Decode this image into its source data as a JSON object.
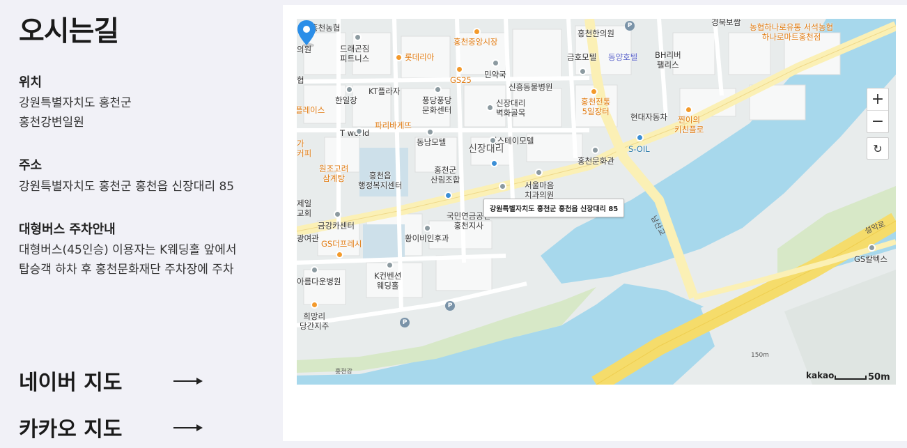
{
  "heading": "오시는길",
  "location": {
    "label": "위치",
    "line1": "강원특별자치도 홍천군",
    "line2": "홍천강변일원"
  },
  "address": {
    "label": "주소",
    "value": "강원특별자치도 홍천군 홍천읍 신장대리 85"
  },
  "bus": {
    "label": "대형버스 주차안내",
    "line1": "대형버스(45인승) 이용자는 K웨딩홀 앞에서",
    "line2": "탑승객 하차 후 홍천문화재단 주차장에 주차"
  },
  "links": {
    "naver": "네이버 지도",
    "kakao": "카카오 지도"
  },
  "map": {
    "callout": "강원특별자치도 홍천군 홍천읍 신장대리 85",
    "zoom_in": "+",
    "zoom_out": "−",
    "reset": "↻",
    "brand": "kakao",
    "scale": "50m",
    "labels": [
      {
        "t": "홍천농협",
        "c": ""
      },
      {
        "t": "드래곤짐\n피트니스",
        "c": ""
      },
      {
        "t": "롯데리아",
        "c": "o"
      },
      {
        "t": "홍천중앙시장",
        "c": "o"
      },
      {
        "t": "홍천한의원",
        "c": ""
      },
      {
        "t": "경북보쌈",
        "c": ""
      },
      {
        "t": "농협하나로유통 서석농협\n하나로마트홍천점",
        "c": "o"
      },
      {
        "t": "금호모텔",
        "c": ""
      },
      {
        "t": "동양호텔",
        "c": "p"
      },
      {
        "t": "BH리버\n팰리스",
        "c": ""
      },
      {
        "t": "민약국",
        "c": ""
      },
      {
        "t": "GS25",
        "c": "o"
      },
      {
        "t": "신흥동물병원",
        "c": ""
      },
      {
        "t": "KT플라자",
        "c": ""
      },
      {
        "t": "한일장",
        "c": ""
      },
      {
        "t": "풍당풍당\n문화센터",
        "c": ""
      },
      {
        "t": "신장대리\n벽화골목",
        "c": ""
      },
      {
        "t": "홍천전통\n5일장터",
        "c": "o"
      },
      {
        "t": "현대자동차",
        "c": ""
      },
      {
        "t": "찐이의\n키친플로",
        "c": "o"
      },
      {
        "t": "파리바게뜨",
        "c": "o"
      },
      {
        "t": "T world",
        "c": ""
      },
      {
        "t": "동남모텔",
        "c": ""
      },
      {
        "t": "더스테이모텔",
        "c": ""
      },
      {
        "t": "신장대리",
        "c": "big"
      },
      {
        "t": "S-OIL",
        "c": "b"
      },
      {
        "t": "홍천문화관",
        "c": ""
      },
      {
        "t": "원조고려\n삼계탕",
        "c": "o"
      },
      {
        "t": "홍천읍\n행정복지센터",
        "c": ""
      },
      {
        "t": "홍천군\n산림조합",
        "c": ""
      },
      {
        "t": "서울마음\n치과의원",
        "c": ""
      },
      {
        "t": "금강카센터",
        "c": ""
      },
      {
        "t": "GS더프레시",
        "c": "o"
      },
      {
        "t": "국민연금공단\n홍천지사",
        "c": ""
      },
      {
        "t": "황이비인후과",
        "c": ""
      },
      {
        "t": "K컨벤션\n웨딩홀",
        "c": ""
      },
      {
        "t": "아름다운병원",
        "c": ""
      },
      {
        "t": "희망리\n당간지주",
        "c": ""
      },
      {
        "t": "GS칼텍스",
        "c": ""
      },
      {
        "t": "설악로",
        "c": "road"
      },
      {
        "t": "남산교",
        "c": "road"
      },
      {
        "t": "홍천강",
        "c": "road"
      },
      {
        "t": "150m",
        "c": "road"
      },
      {
        "t": "플레이스",
        "c": "o"
      },
      {
        "t": "가\n커피",
        "c": "o"
      },
      {
        "t": "의원",
        "c": ""
      },
      {
        "t": "협",
        "c": ""
      },
      {
        "t": "제일\n교회",
        "c": ""
      },
      {
        "t": "광여관",
        "c": ""
      }
    ]
  }
}
